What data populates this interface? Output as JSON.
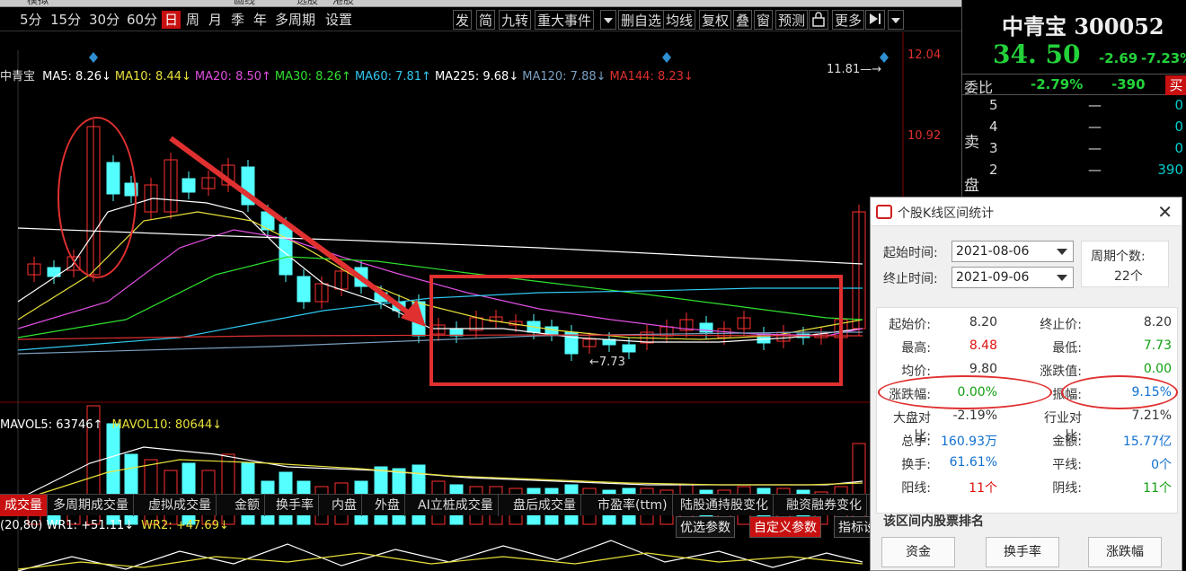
{
  "top_strip": [
    "模拟",
    "画线",
    "选股",
    "港股"
  ],
  "toolbar": {
    "periods": [
      "5分",
      "15分",
      "30分",
      "60分",
      "日",
      "周",
      "月",
      "季",
      "年",
      "多周期",
      "设置"
    ],
    "active_period": "日",
    "tools": [
      "发",
      "简",
      "九转",
      "重大事件",
      "删自选",
      "均线",
      "复权",
      "叠",
      "窗",
      "预测",
      "更多"
    ]
  },
  "ma_line": {
    "name": "中青宝",
    "items": [
      {
        "label": "MA5: 8.26↓",
        "color": "#ffffff"
      },
      {
        "label": "MA10: 8.44↓",
        "color": "#e8e03a"
      },
      {
        "label": "MA20: 8.50↑",
        "color": "#e04ee0"
      },
      {
        "label": "MA30: 8.26↑",
        "color": "#30e030"
      },
      {
        "label": "MA60: 7.81↑",
        "color": "#30c8f0"
      },
      {
        "label": "MA225: 9.68↓",
        "color": "#ffffff"
      },
      {
        "label": "MA120: 7.88↓",
        "color": "#7aa0c0"
      },
      {
        "label": "MA144: 8.23↓",
        "color": "#e03030"
      }
    ]
  },
  "price_axis": [
    "12.04",
    "10.92"
  ],
  "price_annotations": {
    "high_marker": "11.81",
    "low_marker": "7.73"
  },
  "volume_line": [
    {
      "label": "MAVOL5: 63746↑",
      "color": "#ffffff"
    },
    {
      "label": "MAVOL10: 80644↓",
      "color": "#e8e03a"
    }
  ],
  "tabs": [
    "成交量",
    "多周期成交量",
    "虚拟成交量",
    "金额",
    "换手率",
    "内盘",
    "外盘",
    "AI立桩成交量",
    "盘后成交量",
    "市盈率(ttm)",
    "陆股通持股变化",
    "融资融券变化"
  ],
  "wr_line": [
    {
      "label": "(20,80)  WR1: +51.11↓",
      "color": "#ffffff"
    },
    {
      "label": "WR2: +47.69↓",
      "color": "#e8e03a"
    }
  ],
  "wr_buttons": [
    "优选参数",
    "自定义参数",
    "指标设"
  ],
  "quote": {
    "name": "中青宝 300052",
    "price": "34. 50",
    "change": "-2.69",
    "pct": "-7.23%",
    "weibi_label": "委比",
    "weibi_pct": "-2.79%",
    "weibi_val": "-390",
    "buy_label": "买",
    "sell_label": "卖盘",
    "rows": [
      {
        "n": "5",
        "p": "—",
        "v": "0"
      },
      {
        "n": "4",
        "p": "—",
        "v": "0"
      },
      {
        "n": "3",
        "p": "—",
        "v": "0"
      },
      {
        "n": "2",
        "p": "—",
        "v": "390"
      }
    ]
  },
  "dialog": {
    "title": "个股K线区间统计",
    "start_label": "起始时间:",
    "start_value": "2021-08-06",
    "end_label": "终止时间:",
    "end_value": "2021-09-06",
    "period_label": "周期个数:",
    "period_value": "22个",
    "stats": [
      {
        "l": "起始价:",
        "v": "8.20",
        "c": "dark",
        "l2": "终止价:",
        "v2": "8.20",
        "c2": "dark"
      },
      {
        "l": "最高:",
        "v": "8.48",
        "c": "red",
        "l2": "最低:",
        "v2": "7.73",
        "c2": "green"
      },
      {
        "l": "均价:",
        "v": "9.80",
        "c": "dark",
        "l2": "涨跌值:",
        "v2": "0.00",
        "c2": "green"
      },
      {
        "l": "涨跌幅:",
        "v": "0.00%",
        "c": "green",
        "l2": "振幅:",
        "v2": "9.15%",
        "c2": "blue"
      },
      {
        "l": "大盘对比:",
        "v": "-2.19%",
        "c": "dark",
        "l2": "行业对比:",
        "v2": "7.21%",
        "c2": "dark"
      },
      {
        "l": "总手:",
        "v": "160.93万",
        "c": "blue",
        "l2": "金额:",
        "v2": "15.77亿",
        "c2": "blue"
      },
      {
        "l": "换手:",
        "v": "61.61%",
        "c": "blue",
        "l2": "平线:",
        "v2": "0个",
        "c2": "blue"
      },
      {
        "l": "阳线:",
        "v": "11个",
        "c": "red",
        "l2": "阴线:",
        "v2": "11个",
        "c2": "green"
      }
    ],
    "rank_title": "该区间内股票排名",
    "rank_buttons": [
      "资金",
      "换手率",
      "涨跌幅"
    ]
  }
}
